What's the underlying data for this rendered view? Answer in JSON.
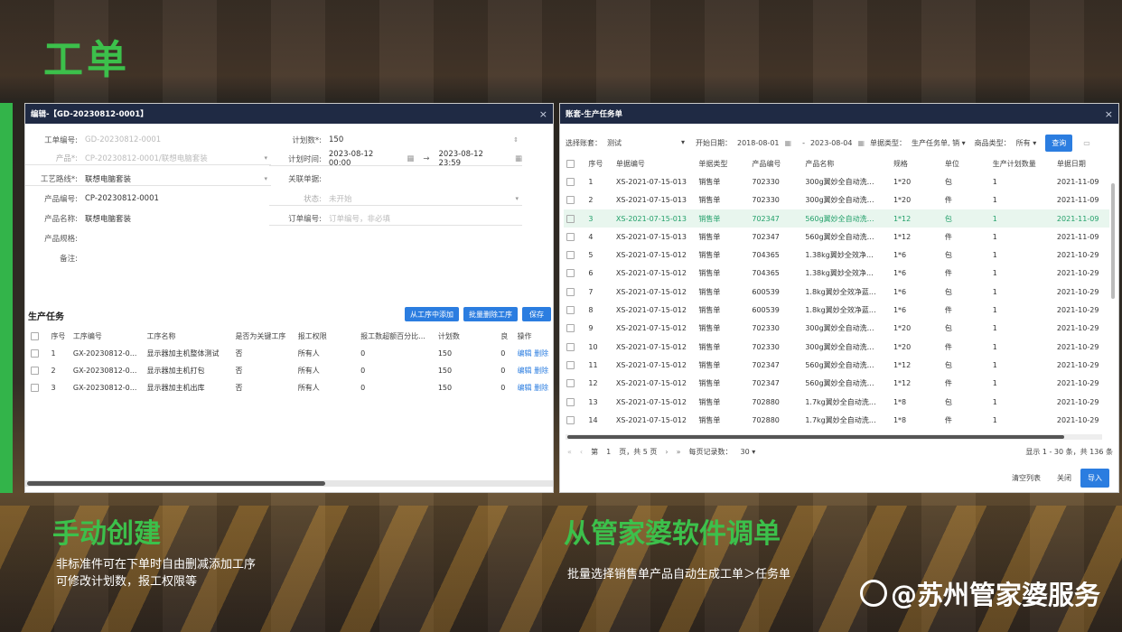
{
  "slide": {
    "title": "工单",
    "left_heading": "手动创建",
    "left_desc_1": "非标准件可在下单时自由删减添加工序",
    "left_desc_2": "可修改计划数，报工权限等",
    "right_heading": "从管家婆软件调单",
    "right_desc": "批量选择销售单产品自动生成工单＞任务单",
    "watermark": "@苏州管家婆服务"
  },
  "edit_window": {
    "title": "编辑-【GD-20230812-0001】",
    "close": "×",
    "fields": {
      "order_no_label": "工单编号:",
      "order_no_value": "GD-20230812-0001",
      "product_label": "产品*:",
      "product_value": "CP-20230812-0001/联想电脑套装",
      "route_label": "工艺路线*:",
      "route_value": "联想电脑套装",
      "prod_code_label": "产品编号:",
      "prod_code_value": "CP-20230812-0001",
      "prod_name_label": "产品名称:",
      "prod_name_value": "联想电脑套装",
      "prod_spec_label": "产品规格:",
      "remark_label": "备注:",
      "plan_qty_label": "计划数*:",
      "plan_qty_value": "150",
      "plan_time_label": "计划时间:",
      "plan_start": "2023-08-12 00:00",
      "plan_arrow": "→",
      "plan_end": "2023-08-12 23:59",
      "linked_label": "关联单据:",
      "status_label": "状态:",
      "status_value": "未开始",
      "order_ref_label": "订单编号:",
      "order_ref_placeholder": "订单编号，非必填"
    },
    "section_title": "生产任务",
    "buttons": {
      "add_from_process": "从工序中添加",
      "batch_delete": "批量删除工序",
      "save": "保存"
    },
    "columns": [
      "序号",
      "工序编号",
      "工序名称",
      "是否为关键工序",
      "报工权限",
      "报工数超额百分比...",
      "计划数",
      "良",
      "操作"
    ],
    "rows": [
      {
        "no": "1",
        "code": "GX-20230812-0...",
        "name": "显示器加主机整体测试",
        "key": "否",
        "perm": "所有人",
        "pct": "0",
        "qty": "150",
        "good": "0",
        "edit": "编辑",
        "del": "删除"
      },
      {
        "no": "2",
        "code": "GX-20230812-0...",
        "name": "显示器加主机打包",
        "key": "否",
        "perm": "所有人",
        "pct": "0",
        "qty": "150",
        "good": "0",
        "edit": "编辑",
        "del": "删除"
      },
      {
        "no": "3",
        "code": "GX-20230812-0...",
        "name": "显示器加主机出库",
        "key": "否",
        "perm": "所有人",
        "pct": "0",
        "qty": "150",
        "good": "0",
        "edit": "编辑",
        "del": "删除"
      }
    ]
  },
  "select_window": {
    "title": "账套-生产任务单",
    "close": "×",
    "toolbar": {
      "book_label": "选择账套：",
      "book_value": "测试",
      "start_label": "开始日期：",
      "start_value": "2018-08-01",
      "end_sep": "-",
      "end_value": "2023-08-04",
      "type_label": "单据类型：",
      "type_value": "生产任务单, 销",
      "goods_label": "商品类型：",
      "goods_value": "所有",
      "query": "查询"
    },
    "columns": [
      "序号",
      "单据编号",
      "单据类型",
      "产品编号",
      "产品名称",
      "规格",
      "单位",
      "生产计划数量",
      "单据日期"
    ],
    "rows": [
      [
        "1",
        "XS-2021-07-15-013",
        "销售单",
        "702330",
        "300g翼妙全自动洗…",
        "1*20",
        "包",
        "1",
        "2021-11-09"
      ],
      [
        "2",
        "XS-2021-07-15-013",
        "销售单",
        "702330",
        "300g翼妙全自动洗…",
        "1*20",
        "件",
        "1",
        "2021-11-09"
      ],
      [
        "3",
        "XS-2021-07-15-013",
        "销售单",
        "702347",
        "560g翼妙全自动洗…",
        "1*12",
        "包",
        "1",
        "2021-11-09"
      ],
      [
        "4",
        "XS-2021-07-15-013",
        "销售单",
        "702347",
        "560g翼妙全自动洗…",
        "1*12",
        "件",
        "1",
        "2021-11-09"
      ],
      [
        "5",
        "XS-2021-07-15-012",
        "销售单",
        "704365",
        "1.38kg翼妙全效净…",
        "1*6",
        "包",
        "1",
        "2021-10-29"
      ],
      [
        "6",
        "XS-2021-07-15-012",
        "销售单",
        "704365",
        "1.38kg翼妙全效净…",
        "1*6",
        "件",
        "1",
        "2021-10-29"
      ],
      [
        "7",
        "XS-2021-07-15-012",
        "销售单",
        "600539",
        "1.8kg翼妙全效净蓝…",
        "1*6",
        "包",
        "1",
        "2021-10-29"
      ],
      [
        "8",
        "XS-2021-07-15-012",
        "销售单",
        "600539",
        "1.8kg翼妙全效净蓝…",
        "1*6",
        "件",
        "1",
        "2021-10-29"
      ],
      [
        "9",
        "XS-2021-07-15-012",
        "销售单",
        "702330",
        "300g翼妙全自动洗…",
        "1*20",
        "包",
        "1",
        "2021-10-29"
      ],
      [
        "10",
        "XS-2021-07-15-012",
        "销售单",
        "702330",
        "300g翼妙全自动洗…",
        "1*20",
        "件",
        "1",
        "2021-10-29"
      ],
      [
        "11",
        "XS-2021-07-15-012",
        "销售单",
        "702347",
        "560g翼妙全自动洗…",
        "1*12",
        "包",
        "1",
        "2021-10-29"
      ],
      [
        "12",
        "XS-2021-07-15-012",
        "销售单",
        "702347",
        "560g翼妙全自动洗…",
        "1*12",
        "件",
        "1",
        "2021-10-29"
      ],
      [
        "13",
        "XS-2021-07-15-012",
        "销售单",
        "702880",
        "1.7kg翼妙全自动洗…",
        "1*8",
        "包",
        "1",
        "2021-10-29"
      ],
      [
        "14",
        "XS-2021-07-15-012",
        "销售单",
        "702880",
        "1.7kg翼妙全自动洗…",
        "1*8",
        "件",
        "1",
        "2021-10-29"
      ]
    ],
    "highlight_row": "3",
    "pager": {
      "first": "«",
      "prev": "‹",
      "page_label": "第",
      "page_value": "1",
      "page_suffix": "页，共 5 页",
      "next": "›",
      "last": "»",
      "per_page_label": "每页记录数：",
      "per_page_value": "30",
      "summary": "显示 1 - 30 条，共 136 条"
    },
    "footer": {
      "clear": "清空列表",
      "close": "关闭",
      "import": "导入"
    }
  }
}
